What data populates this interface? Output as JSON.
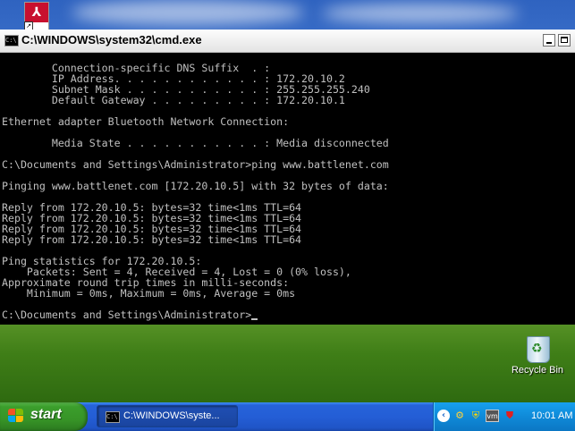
{
  "window": {
    "title": "C:\\WINDOWS\\system32\\cmd.exe"
  },
  "console": {
    "lines": [
      "        Connection-specific DNS Suffix  . :",
      "        IP Address. . . . . . . . . . . . : 172.20.10.2",
      "        Subnet Mask . . . . . . . . . . . : 255.255.255.240",
      "        Default Gateway . . . . . . . . . : 172.20.10.1",
      "",
      "Ethernet adapter Bluetooth Network Connection:",
      "",
      "        Media State . . . . . . . . . . . : Media disconnected",
      "",
      "C:\\Documents and Settings\\Administrator>ping www.battlenet.com",
      "",
      "Pinging www.battlenet.com [172.20.10.5] with 32 bytes of data:",
      "",
      "Reply from 172.20.10.5: bytes=32 time<1ms TTL=64",
      "Reply from 172.20.10.5: bytes=32 time<1ms TTL=64",
      "Reply from 172.20.10.5: bytes=32 time<1ms TTL=64",
      "Reply from 172.20.10.5: bytes=32 time<1ms TTL=64",
      "",
      "Ping statistics for 172.20.10.5:",
      "    Packets: Sent = 4, Received = 4, Lost = 0 (0% loss),",
      "Approximate round trip times in milli-seconds:",
      "    Minimum = 0ms, Maximum = 0ms, Average = 0ms",
      "",
      "C:\\Documents and Settings\\Administrator>"
    ]
  },
  "desktop": {
    "recycle_bin_label": "Recycle Bin"
  },
  "taskbar": {
    "start_label": "start",
    "task_label": "C:\\WINDOWS\\syste...",
    "clock": "10:01 AM"
  },
  "colors": {
    "console_bg": "#000000",
    "console_fg": "#c0c0c0",
    "taskbar_blue": "#245ed6",
    "start_green": "#379427",
    "tray_blue": "#0f8ad8"
  },
  "icons": {
    "desktop_shortcut": "acrobat-icon",
    "window_icon": "cmd-icon",
    "tray": [
      "show-hidden-icons-chevron",
      "network-icon",
      "security-shield-icon",
      "vmware-icon",
      "alert-shield-icon"
    ]
  }
}
